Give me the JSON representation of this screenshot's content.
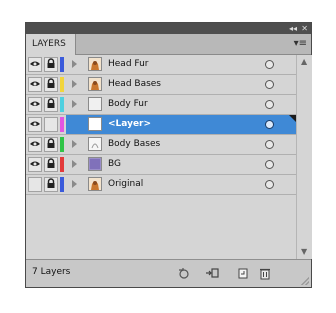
{
  "panel": {
    "tab_label": "LAYERS",
    "collapse_icon": "double-chevron-left-icon",
    "close_icon": "close-icon",
    "menu_icon": "panel-menu-icon",
    "collapse_glyph": "◂◂",
    "close_glyph": "✕",
    "menu_glyph": "▾≡"
  },
  "layers": [
    {
      "name": "Head Fur",
      "color": "#3b5bdb",
      "visible": true,
      "locked": true,
      "thumb": "figure",
      "selected": false
    },
    {
      "name": "Head Bases",
      "color": "#f2d53c",
      "visible": true,
      "locked": true,
      "thumb": "figure",
      "selected": false
    },
    {
      "name": "Body Fur",
      "color": "#4fd0e0",
      "visible": true,
      "locked": true,
      "thumb": "blank",
      "selected": false
    },
    {
      "name": "<Layer>",
      "color": "#e255e2",
      "visible": true,
      "locked": false,
      "thumb": "white",
      "selected": true
    },
    {
      "name": "Body Bases",
      "color": "#2fc447",
      "visible": true,
      "locked": true,
      "thumb": "sketch",
      "selected": false
    },
    {
      "name": "BG",
      "color": "#e33a3a",
      "visible": true,
      "locked": true,
      "thumb": "purple",
      "selected": false
    },
    {
      "name": "Original",
      "color": "#3b5bdb",
      "visible": false,
      "locked": true,
      "thumb": "figure",
      "selected": false
    }
  ],
  "footer": {
    "layer_count": "7 Layers"
  },
  "colors": {
    "selection": "#3f89d6",
    "panel_bg": "#d5d5d5",
    "titlebar": "#4e4e4e"
  }
}
